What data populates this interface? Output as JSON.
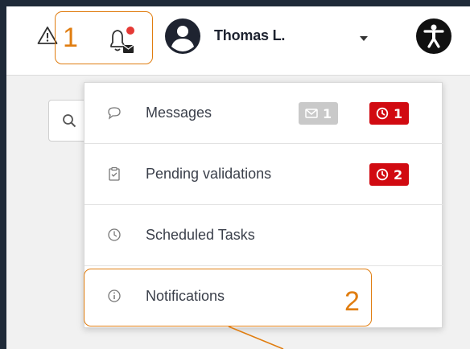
{
  "header": {
    "user_name": "Thomas L."
  },
  "menu": {
    "items": [
      {
        "label": "Messages",
        "icon": "chat-bubble-icon"
      },
      {
        "label": "Pending validations",
        "icon": "clipboard-check-icon"
      },
      {
        "label": "Scheduled Tasks",
        "icon": "clock-icon"
      },
      {
        "label": "Notifications",
        "icon": "info-icon"
      }
    ],
    "messages_badges": {
      "mail_count": "1",
      "overdue_count": "1"
    },
    "pending_badges": {
      "overdue_count": "2"
    }
  },
  "callouts": {
    "first": "1",
    "second": "2"
  },
  "colors": {
    "frame": "#1f2a38",
    "callout": "#e07d10",
    "badge_red": "#d10a11",
    "badge_grey": "#c9c9c9",
    "notification_dot": "#e53935"
  }
}
